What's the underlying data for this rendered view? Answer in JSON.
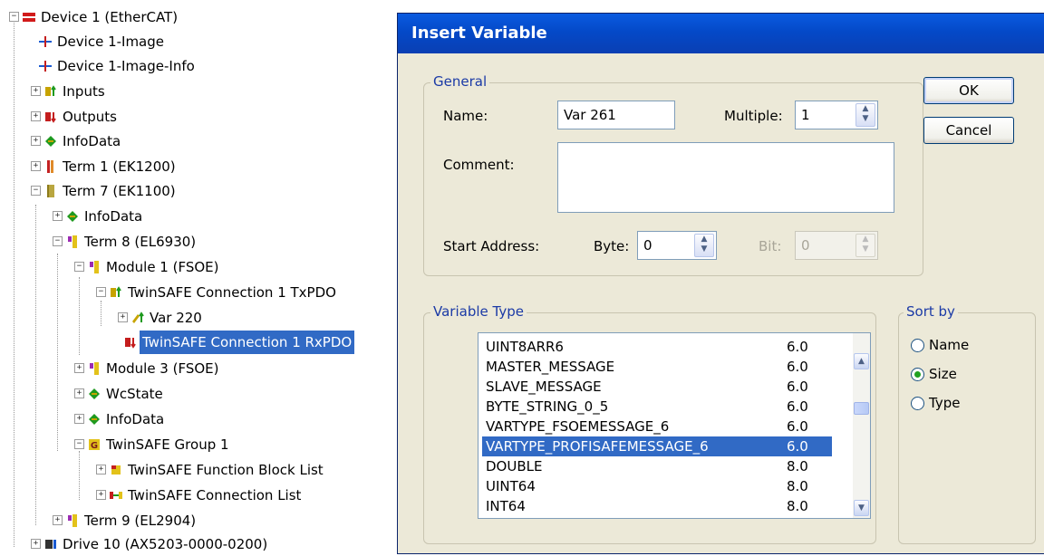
{
  "tree": {
    "nodes": [
      {
        "label": "Device 1 (EtherCAT)",
        "icon": "ethercat-device-icon",
        "color": "#d11a1a"
      },
      {
        "label": "Device 1-Image",
        "icon": "image-icon",
        "color": "#1a5ad1"
      },
      {
        "label": "Device 1-Image-Info",
        "icon": "image-info-icon",
        "color": "#1a5ad1"
      },
      {
        "label": "Inputs",
        "icon": "inputs-icon",
        "color": "#c7a300"
      },
      {
        "label": "Outputs",
        "icon": "outputs-icon",
        "color": "#c41e1e"
      },
      {
        "label": "InfoData",
        "icon": "infodata-icon",
        "color": "#1f9a1f"
      },
      {
        "label": "Term 1 (EK1200)",
        "icon": "terminal-icon",
        "color": "#c42222"
      },
      {
        "label": "Term 7 (EK1100)",
        "icon": "terminal-icon",
        "color": "#b9a640"
      },
      {
        "label": "InfoData",
        "icon": "infodata-icon",
        "color": "#1f9a1f"
      },
      {
        "label": "Term 8 (EL6930)",
        "icon": "terminal-icon",
        "color": "#9b2bb3"
      },
      {
        "label": "Module 1 (FSOE)",
        "icon": "module-icon",
        "color": "#9b2bb3"
      },
      {
        "label": "TwinSAFE Connection 1 TxPDO",
        "icon": "txpdo-icon",
        "color": "#c7a300"
      },
      {
        "label": "Var 220",
        "icon": "variable-icon",
        "color": "#c7a300"
      },
      {
        "label": "TwinSAFE Connection 1 RxPDO",
        "icon": "rxpdo-icon",
        "color": "#c41e1e"
      },
      {
        "label": "Module 3 (FSOE)",
        "icon": "module-icon",
        "color": "#9b2bb3"
      },
      {
        "label": "WcState",
        "icon": "wcstate-icon",
        "color": "#1f9a1f"
      },
      {
        "label": "InfoData",
        "icon": "infodata-icon",
        "color": "#1f9a1f"
      },
      {
        "label": "TwinSAFE Group 1",
        "icon": "group-icon",
        "color": "#c7a300"
      },
      {
        "label": "TwinSAFE Function Block List",
        "icon": "function-block-icon",
        "color": "#c7a300"
      },
      {
        "label": "TwinSAFE Connection List",
        "icon": "connection-list-icon",
        "color": "#c7a300"
      },
      {
        "label": "Term 9 (EL2904)",
        "icon": "terminal-icon",
        "color": "#9b2bb3"
      },
      {
        "label": "Drive 10 (AX5203-0000-0200)",
        "icon": "drive-icon",
        "color": "#333333"
      }
    ]
  },
  "dialog": {
    "title": "Insert Variable",
    "general": {
      "legend": "General",
      "name_label": "Name:",
      "name_value": "Var 261",
      "multiple_label": "Multiple:",
      "multiple_value": "1",
      "comment_label": "Comment:",
      "comment_value": "",
      "start_address_label": "Start Address:",
      "byte_label": "Byte:",
      "byte_value": "0",
      "bit_label": "Bit:",
      "bit_value": "0"
    },
    "ok_label": "OK",
    "cancel_label": "Cancel",
    "variable_type": {
      "legend": "Variable Type",
      "rows": [
        {
          "name": "UINT8ARR6",
          "size": "6.0"
        },
        {
          "name": "MASTER_MESSAGE",
          "size": "6.0"
        },
        {
          "name": "SLAVE_MESSAGE",
          "size": "6.0"
        },
        {
          "name": "BYTE_STRING_0_5",
          "size": "6.0"
        },
        {
          "name": "VARTYPE_FSOEMESSAGE_6",
          "size": "6.0"
        },
        {
          "name": "VARTYPE_PROFISAFEMESSAGE_6",
          "size": "6.0"
        },
        {
          "name": "DOUBLE",
          "size": "8.0"
        },
        {
          "name": "UINT64",
          "size": "8.0"
        },
        {
          "name": "INT64",
          "size": "8.0"
        }
      ],
      "selected_index": 5
    },
    "sort_by": {
      "legend": "Sort by",
      "options": [
        "Name",
        "Size",
        "Type"
      ],
      "selected": "Size"
    }
  },
  "colors": {
    "selection": "#316ac5",
    "title_bar": "#0a5be0",
    "dialog_bg": "#ece9d8",
    "group_legend": "#1b3aa6",
    "radio_dot": "#21a121"
  }
}
